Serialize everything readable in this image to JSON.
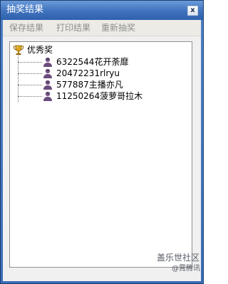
{
  "window": {
    "title": "抽奖结果",
    "close_label": "x"
  },
  "menu": {
    "items": [
      {
        "label": "保存结果"
      },
      {
        "label": "打印结果"
      },
      {
        "label": "重新抽奖"
      }
    ]
  },
  "tree": {
    "root": {
      "label": "优秀奖",
      "icon": "trophy-icon",
      "children": [
        {
          "label": "6322544花开荼靡",
          "icon": "person-icon"
        },
        {
          "label": "20472231rlryu",
          "icon": "person-icon"
        },
        {
          "label": "577887主播亦凡",
          "icon": "person-icon"
        },
        {
          "label": "11250264菠萝哥拉木",
          "icon": "person-icon"
        }
      ]
    }
  },
  "watermark": {
    "text": "盖乐世社区",
    "sub": "@霄腾讯"
  },
  "colors": {
    "titlebar": "#3f72bd",
    "client_bg": "#f0f0f0",
    "menu_text_disabled": "#8f8f8f"
  }
}
